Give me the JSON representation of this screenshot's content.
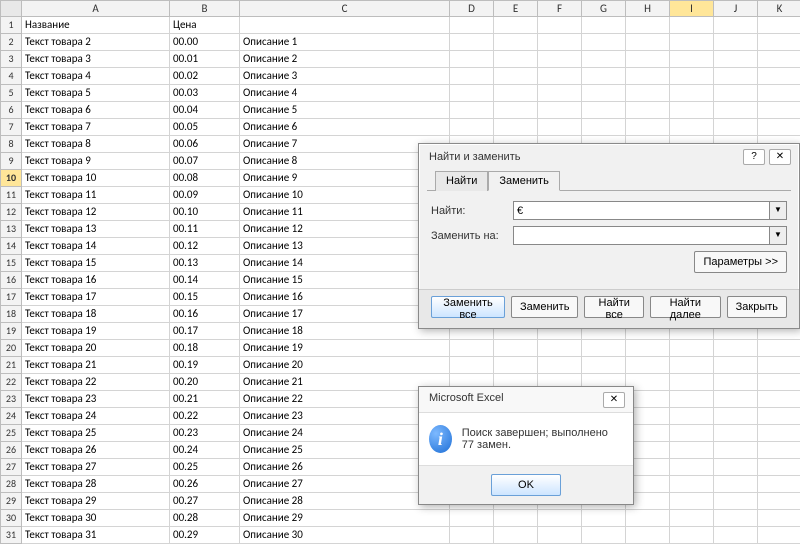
{
  "columns": [
    "A",
    "B",
    "C",
    "D",
    "E",
    "F",
    "G",
    "H",
    "I",
    "J",
    "K"
  ],
  "selected_column": "I",
  "selected_row": 10,
  "headers": {
    "A": "Название",
    "B": "Цена",
    "C": ""
  },
  "rows": [
    {
      "n": 2,
      "A": "Текст товара 2",
      "B": "00.00",
      "C": "Описание 1"
    },
    {
      "n": 3,
      "A": "Текст товара 3",
      "B": "00.01",
      "C": "Описание 2"
    },
    {
      "n": 4,
      "A": "Текст товара 4",
      "B": "00.02",
      "C": "Описание 3"
    },
    {
      "n": 5,
      "A": "Текст товара 5",
      "B": "00.03",
      "C": "Описание 4"
    },
    {
      "n": 6,
      "A": "Текст товара 6",
      "B": "00.04",
      "C": "Описание 5"
    },
    {
      "n": 7,
      "A": "Текст товара 7",
      "B": "00.05",
      "C": "Описание 6"
    },
    {
      "n": 8,
      "A": "Текст товара 8",
      "B": "00.06",
      "C": "Описание 7"
    },
    {
      "n": 9,
      "A": "Текст товара 9",
      "B": "00.07",
      "C": "Описание 8"
    },
    {
      "n": 10,
      "A": "Текст товара 10",
      "B": "00.08",
      "C": "Описание 9"
    },
    {
      "n": 11,
      "A": "Текст товара 11",
      "B": "00.09",
      "C": "Описание 10"
    },
    {
      "n": 12,
      "A": "Текст товара 12",
      "B": "00.10",
      "C": "Описание 11"
    },
    {
      "n": 13,
      "A": "Текст товара 13",
      "B": "00.11",
      "C": "Описание 12"
    },
    {
      "n": 14,
      "A": "Текст товара 14",
      "B": "00.12",
      "C": "Описание 13"
    },
    {
      "n": 15,
      "A": "Текст товара 15",
      "B": "00.13",
      "C": "Описание 14"
    },
    {
      "n": 16,
      "A": "Текст товара 16",
      "B": "00.14",
      "C": "Описание 15"
    },
    {
      "n": 17,
      "A": "Текст товара 17",
      "B": "00.15",
      "C": "Описание 16"
    },
    {
      "n": 18,
      "A": "Текст товара 18",
      "B": "00.16",
      "C": "Описание 17"
    },
    {
      "n": 19,
      "A": "Текст товара 19",
      "B": "00.17",
      "C": "Описание 18"
    },
    {
      "n": 20,
      "A": "Текст товара 20",
      "B": "00.18",
      "C": "Описание 19"
    },
    {
      "n": 21,
      "A": "Текст товара 21",
      "B": "00.19",
      "C": "Описание 20"
    },
    {
      "n": 22,
      "A": "Текст товара 22",
      "B": "00.20",
      "C": "Описание 21"
    },
    {
      "n": 23,
      "A": "Текст товара 23",
      "B": "00.21",
      "C": "Описание 22"
    },
    {
      "n": 24,
      "A": "Текст товара 24",
      "B": "00.22",
      "C": "Описание 23"
    },
    {
      "n": 25,
      "A": "Текст товара 25",
      "B": "00.23",
      "C": "Описание 24"
    },
    {
      "n": 26,
      "A": "Текст товара 26",
      "B": "00.24",
      "C": "Описание 25"
    },
    {
      "n": 27,
      "A": "Текст товара 27",
      "B": "00.25",
      "C": "Описание 26"
    },
    {
      "n": 28,
      "A": "Текст товара 28",
      "B": "00.26",
      "C": "Описание 27"
    },
    {
      "n": 29,
      "A": "Текст товара 29",
      "B": "00.27",
      "C": "Описание 28"
    },
    {
      "n": 30,
      "A": "Текст товара 30",
      "B": "00.28",
      "C": "Описание 29"
    },
    {
      "n": 31,
      "A": "Текст товара 31",
      "B": "00.29",
      "C": "Описание 30"
    }
  ],
  "find_replace": {
    "title": "Найти и заменить",
    "tab_find": "Найти",
    "tab_replace": "Заменить",
    "find_label": "Найти:",
    "find_value": "€",
    "replace_label": "Заменить на:",
    "replace_value": "",
    "params_btn": "Параметры >>",
    "btn_replace_all": "Заменить все",
    "btn_replace": "Заменить",
    "btn_find_all": "Найти все",
    "btn_find_next": "Найти далее",
    "btn_close": "Закрыть",
    "help_glyph": "?",
    "close_glyph": "✕"
  },
  "msgbox": {
    "title": "Microsoft Excel",
    "message": "Поиск завершен; выполнено 77 замен.",
    "ok": "OK",
    "close_glyph": "✕",
    "info_glyph": "i"
  }
}
